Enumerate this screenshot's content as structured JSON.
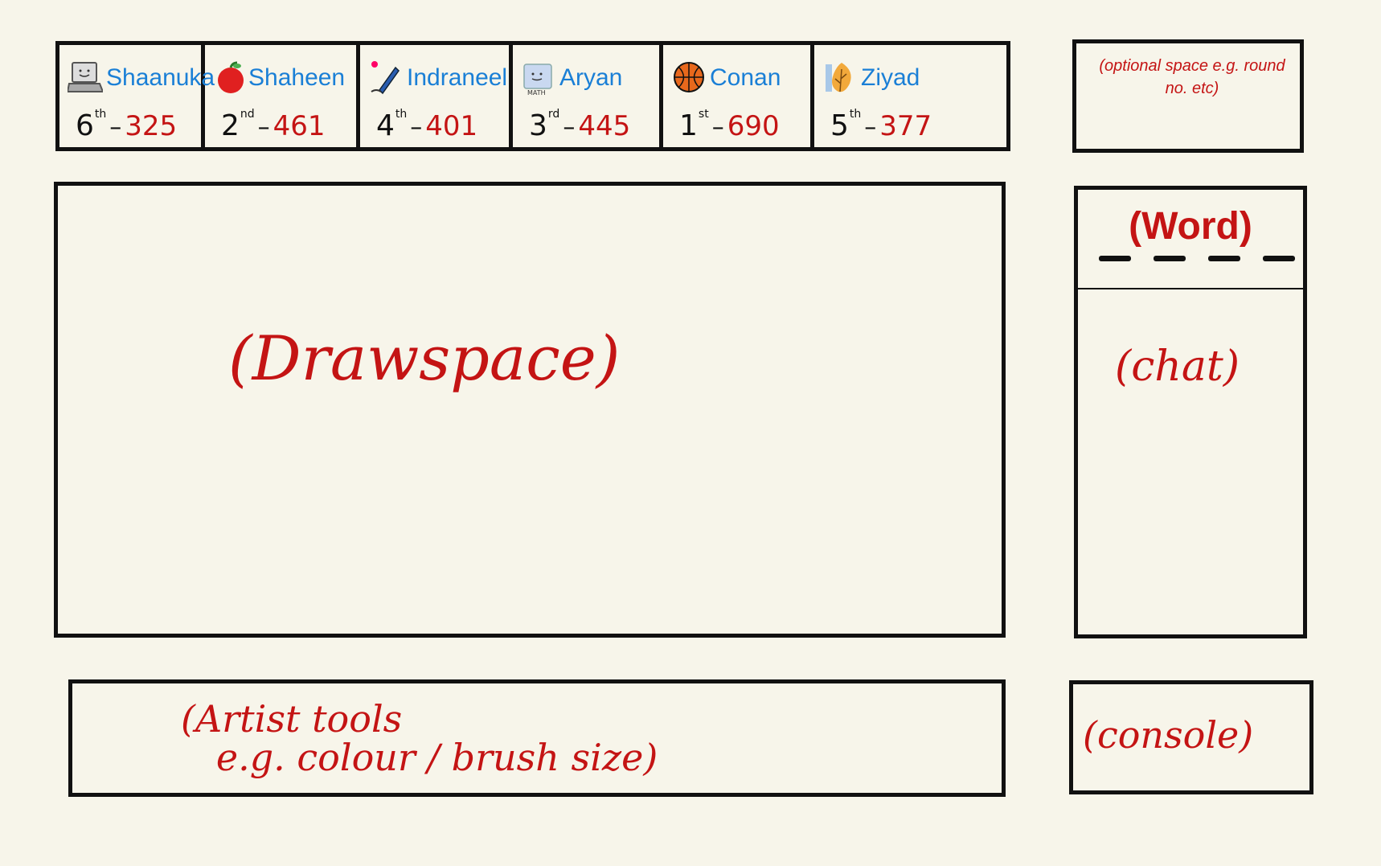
{
  "players": [
    {
      "name": "Shaanuka",
      "rank": "6",
      "suffix": "th",
      "score": "325",
      "icon": "laptop-icon"
    },
    {
      "name": "Shaheen",
      "rank": "2",
      "suffix": "nd",
      "score": "461",
      "icon": "apple-icon"
    },
    {
      "name": "Indraneel",
      "rank": "4",
      "suffix": "th",
      "score": "401",
      "icon": "pen-icon"
    },
    {
      "name": "Aryan",
      "rank": "3",
      "suffix": "rd",
      "score": "445",
      "icon": "math-book-icon"
    },
    {
      "name": "Conan",
      "rank": "1",
      "suffix": "st",
      "score": "690",
      "icon": "basketball-icon"
    },
    {
      "name": "Ziyad",
      "rank": "5",
      "suffix": "th",
      "score": "377",
      "icon": "leaf-icon"
    }
  ],
  "optional_panel": {
    "text": "(optional space e.g. round no. etc)"
  },
  "drawspace": {
    "label": "(Drawspace)"
  },
  "word_panel": {
    "label": "(Word)",
    "blanks": 4
  },
  "chat": {
    "label": "(chat)"
  },
  "artist_tools": {
    "label": "(Artist tools\n   e.g. colour / brush size)"
  },
  "console": {
    "label": "(console)"
  },
  "colors": {
    "name": "#1a7fd6",
    "score": "#c41414",
    "annotation": "#c41414",
    "background": "#f7f5ea"
  }
}
